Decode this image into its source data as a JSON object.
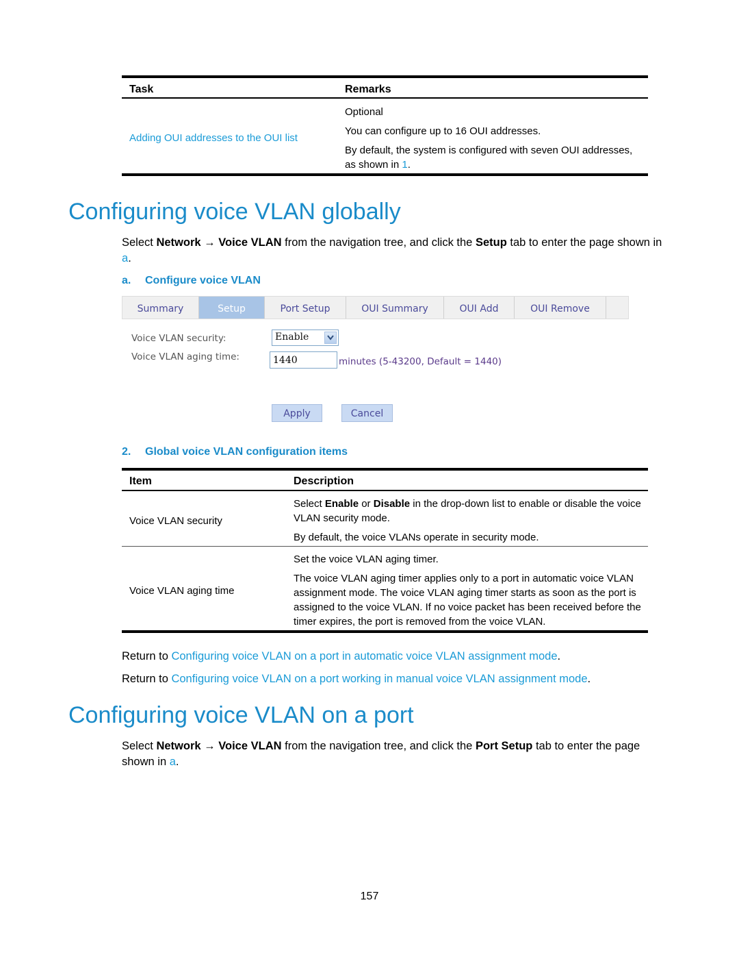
{
  "top_table": {
    "headers": [
      "Task",
      "Remarks"
    ],
    "row": {
      "task_link": "Adding OUI addresses to the OUI list",
      "remarks": [
        "Optional",
        "You can configure up to 16 OUI addresses.",
        "By default, the system is configured with seven OUI addresses,"
      ],
      "remarks_tail_prefix": "as shown in ",
      "remarks_tail_link": "1",
      "remarks_tail_suffix": "."
    }
  },
  "section1": {
    "title": "Configuring voice VLAN globally",
    "intro": {
      "p1": "Select ",
      "b1": "Network",
      "arrow": " → ",
      "b2": "Voice VLAN",
      "p2": " from the navigation tree, and click the ",
      "b3": "Setup",
      "p3": " tab to enter the page shown in",
      "link": "a",
      "end": "."
    },
    "figure_caption": {
      "num": "a.",
      "text": "Configure voice VLAN"
    }
  },
  "webui": {
    "tabs": [
      "Summary",
      "Setup",
      "Port Setup",
      "OUI Summary",
      "OUI Add",
      "OUI Remove"
    ],
    "active_tab": "Setup",
    "security_label": "Voice VLAN security:",
    "security_value": "Enable",
    "aging_label": "Voice VLAN aging time:",
    "aging_value": "1440",
    "aging_hint": "minutes (5-43200, Default = 1440)",
    "apply_label": "Apply",
    "cancel_label": "Cancel"
  },
  "table2": {
    "caption": {
      "num": "2.",
      "text": "Global voice VLAN configuration items"
    },
    "headers": [
      "Item",
      "Description"
    ],
    "rows": [
      {
        "item": "Voice VLAN security",
        "desc_parts": {
          "p1": "Select ",
          "b1": "Enable",
          "p2": " or ",
          "b2": "Disable",
          "p3": " in the drop-down list to enable or disable the voice VLAN security mode."
        },
        "desc2": "By default, the voice VLANs operate in security mode."
      },
      {
        "item": "Voice VLAN aging time",
        "desc1": "Set the voice VLAN aging timer.",
        "desc2": "The voice VLAN aging timer applies only to a port in automatic voice VLAN assignment mode. The voice VLAN aging timer starts as soon as the port is assigned to the voice VLAN. If no voice packet has been received before the timer expires, the port is removed from the voice VLAN."
      }
    ]
  },
  "returns": [
    {
      "prefix": "Return to ",
      "link": "Configuring voice VLAN on a port in automatic voice VLAN assignment mode",
      "suffix": "."
    },
    {
      "prefix": "Return to ",
      "link": "Configuring voice VLAN on a port working in manual voice VLAN assignment mode",
      "suffix": "."
    }
  ],
  "section2": {
    "title": "Configuring voice VLAN on a port",
    "intro": {
      "p1": "Select ",
      "b1": "Network",
      "arrow": " → ",
      "b2": "Voice VLAN",
      "p2": " from the navigation tree, and click the ",
      "b3": "Port Setup",
      "p3": " tab to enter the page shown in ",
      "link": "a",
      "end": "."
    }
  },
  "page_number": "157"
}
